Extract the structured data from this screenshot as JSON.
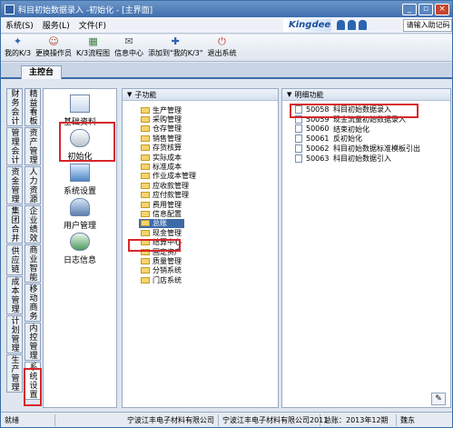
{
  "window": {
    "title": "科目初始数据录入 -初始化 - [主界面]"
  },
  "menu": [
    "系统(S)",
    "服务(L)",
    "文件(F)"
  ],
  "brand": {
    "name": "Kingdee",
    "help_placeholder": "请输入助记码"
  },
  "toolbar": [
    {
      "label": "我的K/3",
      "icon": "k3-icon"
    },
    {
      "label": "更换操作员",
      "icon": "user-switch-icon"
    },
    {
      "label": "K/3流程图",
      "icon": "flowchart-icon"
    },
    {
      "label": "信息中心",
      "icon": "message-icon"
    },
    {
      "label": "添加到\"我的K/3\"",
      "icon": "add-favorite-icon"
    },
    {
      "label": "退出系统",
      "icon": "exit-icon"
    }
  ],
  "tab": {
    "label": "主控台"
  },
  "vtabs_left": [
    "财务会计",
    "管理会计",
    "资金管理",
    "集团合并",
    "供应链",
    "成本管理",
    "计划管理",
    "生产管理"
  ],
  "vtabs_right": [
    "精益看板",
    "资产管理",
    "人力资源",
    "企业绩效",
    "商业智能",
    "移动商务",
    "内控管理",
    "系统设置"
  ],
  "icon_panel": [
    "基础资料",
    "初始化",
    "系统设置",
    "用户管理",
    "日志信息"
  ],
  "subfunctions": {
    "header": "子功能",
    "items": [
      "生产管理",
      "采购管理",
      "仓存管理",
      "销售管理",
      "存货核算",
      "实际成本",
      "标准成本",
      "作业成本管理",
      "应收款管理",
      "应付款管理",
      "费用管理",
      "信息配置",
      "总账",
      "现金管理",
      "结算中心",
      "固定资产",
      "质量管理",
      "分销系统",
      "门店系统"
    ],
    "selected": "总账"
  },
  "functions": {
    "header": "明细功能",
    "items": [
      {
        "code": "50058",
        "name": "科目初始数据录入"
      },
      {
        "code": "50059",
        "name": "现金流量初始数据录入"
      },
      {
        "code": "50060",
        "name": "结束初始化"
      },
      {
        "code": "50061",
        "name": "反初始化"
      },
      {
        "code": "50062",
        "name": "科目初始数据标准模板引出"
      },
      {
        "code": "50063",
        "name": "科目初始数据引入"
      }
    ]
  },
  "status": {
    "ready": "就绪",
    "company1": "宁波江丰电子材料有限公司",
    "company2": "宁波江丰电子材料有限公司2011",
    "period": "总账：2013年12期",
    "user": "魏东"
  }
}
